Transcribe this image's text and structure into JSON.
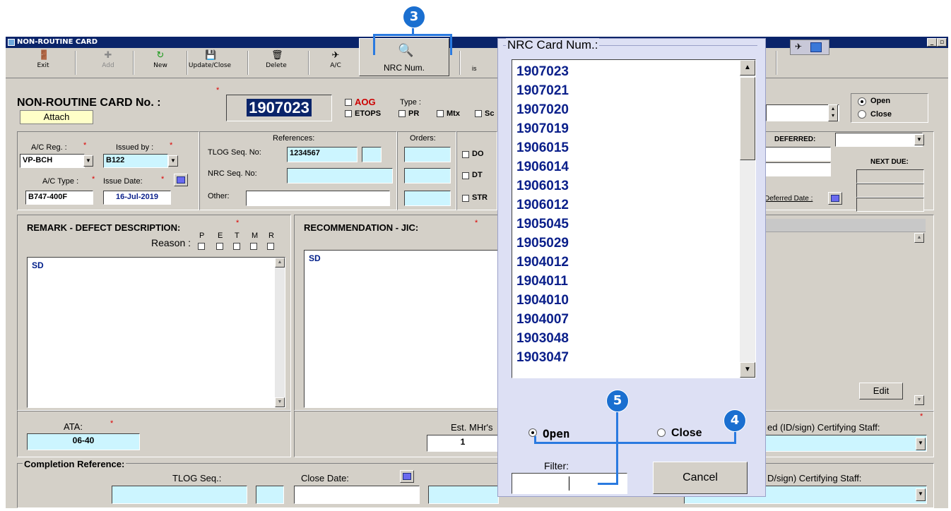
{
  "window": {
    "title": "NON-ROUTINE CARD"
  },
  "toolbar": {
    "exit": "Exit",
    "add": "Add",
    "new": "New",
    "update_close": "Update/Close",
    "delete": "Delete",
    "ac": "A/C",
    "nrc_num": "NRC Num.",
    "partial": "is"
  },
  "header": {
    "card_label": "NON-ROUTINE CARD No. :",
    "card_number": "1907023",
    "attach": "Attach",
    "aog": "AOG",
    "type_label": "Type :",
    "etops": "ETOPS",
    "pr": "PR",
    "mtx": "Mtx",
    "sc": "Sc",
    "open": "Open",
    "close": "Close"
  },
  "details": {
    "ac_reg_label": "A/C Reg. :",
    "ac_reg": "VP-BCH",
    "issued_by_label": "Issued by :",
    "issued_by": "B122",
    "ac_type_label": "A/C Type :",
    "ac_type": "B747-400F",
    "issue_date_label": "Issue Date:",
    "issue_date": "16-Jul-2019",
    "references_label": "References:",
    "tlog_label": "TLOG Seq. No:",
    "tlog": "1234567",
    "nrc_seq_label": "NRC Seq. No:",
    "other_label": "Other:",
    "orders_label": "Orders:",
    "do": "DO",
    "dt": "DT",
    "str": "STR",
    "deferred_label": "DEFERRED:",
    "next_due_label": "NEXT DUE:",
    "deferred_date_label": "Deferred Date :"
  },
  "remark": {
    "title": "REMARK - DEFECT DESCRIPTION:",
    "reason_label": "Reason :",
    "reasons": [
      "P",
      "E",
      "T",
      "M",
      "R"
    ],
    "text": "SD"
  },
  "recommendation": {
    "title": "RECOMMENDATION - JIC:",
    "text": "SD"
  },
  "edit": "Edit",
  "ata": {
    "label": "ATA:",
    "value": "06-40"
  },
  "mhr": {
    "label": "Est. MHr's",
    "value": "1"
  },
  "certifying": {
    "top_label": "ed (ID/sign) Certifying Staff:",
    "bottom_label": "D/sign) Certifying Staff:"
  },
  "completion": {
    "title": "Completion Reference:",
    "tlog_label": "TLOG Seq.:",
    "close_date_label": "Close Date:"
  },
  "popup": {
    "title": "NRC Card Num.:",
    "items": [
      "1907023",
      "1907021",
      "1907020",
      "1907019",
      "1906015",
      "1906014",
      "1906013",
      "1906012",
      "1905045",
      "1905029",
      "1904012",
      "1904011",
      "1904010",
      "1904007",
      "1903048",
      "1903047"
    ],
    "open": "Open",
    "close": "Close",
    "filter_label": "Filter:",
    "cancel": "Cancel"
  },
  "badges": {
    "three": "3",
    "four": "4",
    "five": "5"
  },
  "colors": {
    "field": "#ccf5ff",
    "attach": "#ffffc8",
    "badge": "#1a6fd0",
    "popup_bg": "#dde0f4",
    "list_text": "#0a1f8a"
  }
}
